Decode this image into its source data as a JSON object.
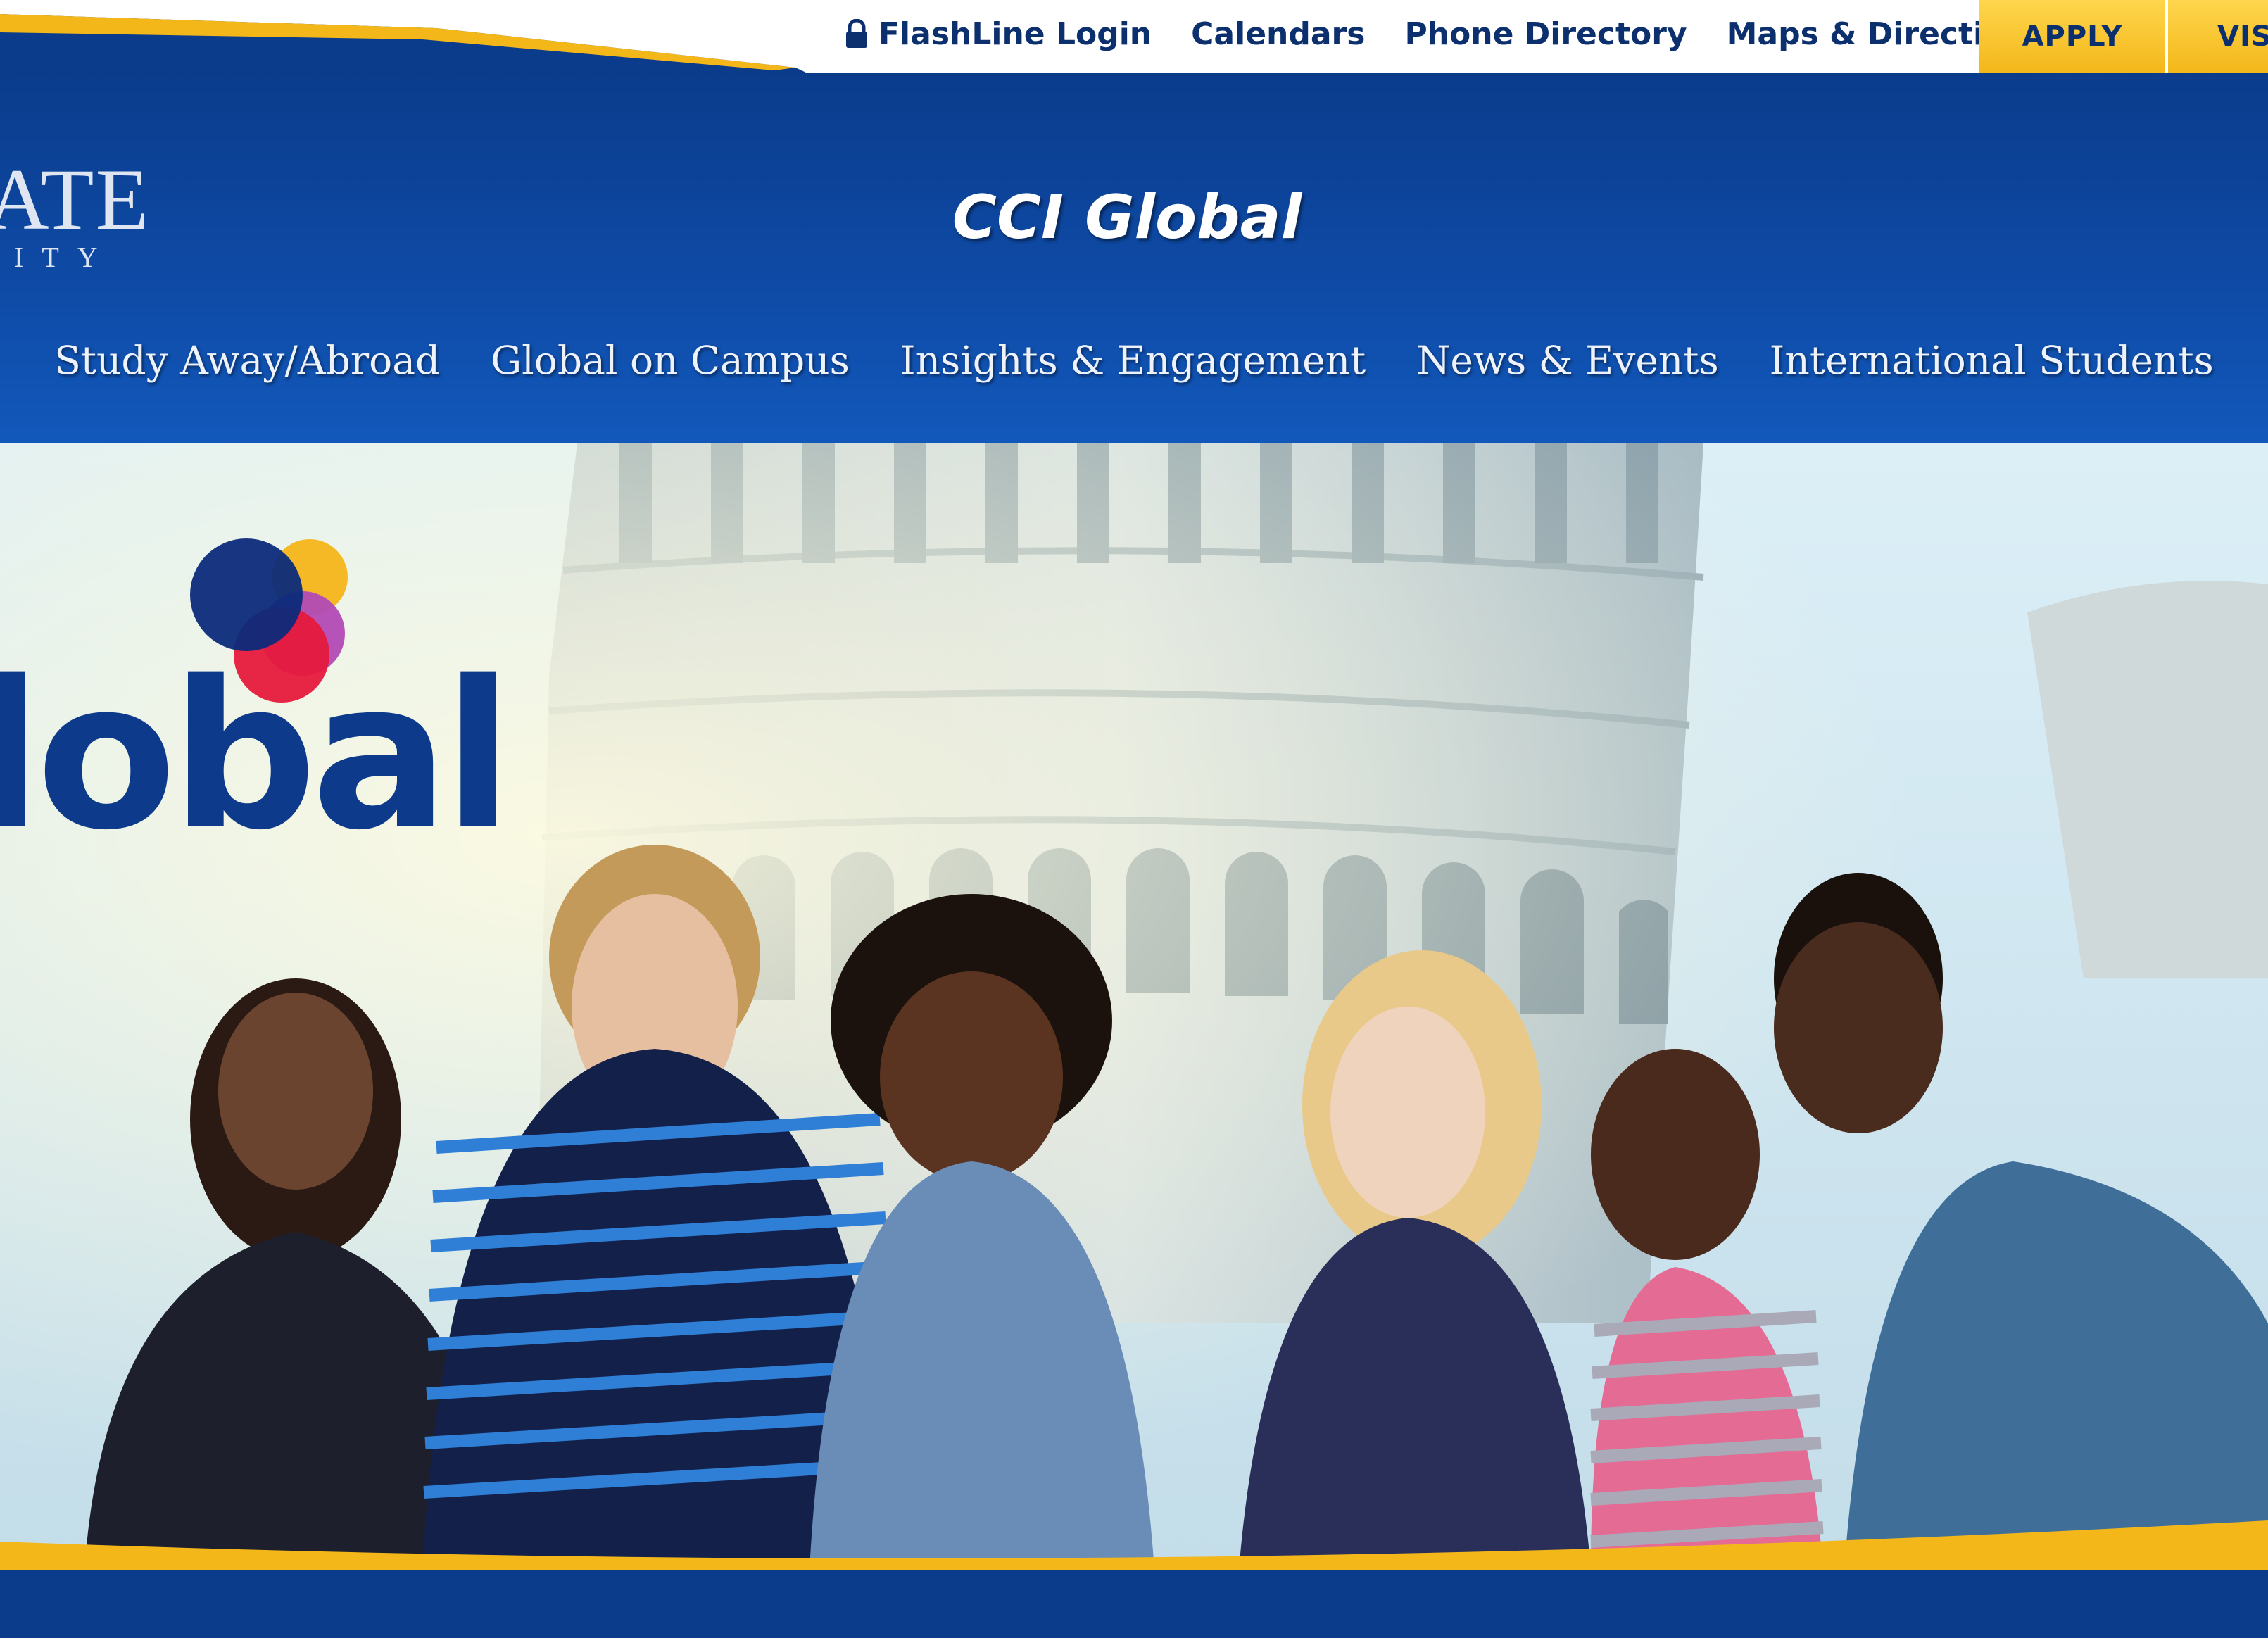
{
  "utility": {
    "links": [
      {
        "label": "FlashLine Login",
        "icon": "lock-icon"
      },
      {
        "label": "Calendars"
      },
      {
        "label": "Phone Directory"
      },
      {
        "label": "Maps & Directions"
      }
    ],
    "apply_label": "APPLY",
    "visit_label": "VISI"
  },
  "header": {
    "logo_main": "ATE",
    "logo_sub": "ITY",
    "title": "CCI Global"
  },
  "nav": [
    {
      "label": "Study Away/Abroad"
    },
    {
      "label": "Global on Campus"
    },
    {
      "label": "Insights & Engagement"
    },
    {
      "label": "News & Events"
    },
    {
      "label": "International Students"
    }
  ],
  "hero": {
    "brand_text": "lobal",
    "image_alt": "Group of six students smiling in front of the Leaning Tower of Pisa"
  },
  "colors": {
    "brand_blue": "#0b3c8c",
    "gold": "#f3b71a",
    "link_navy": "#0c2f6e"
  }
}
